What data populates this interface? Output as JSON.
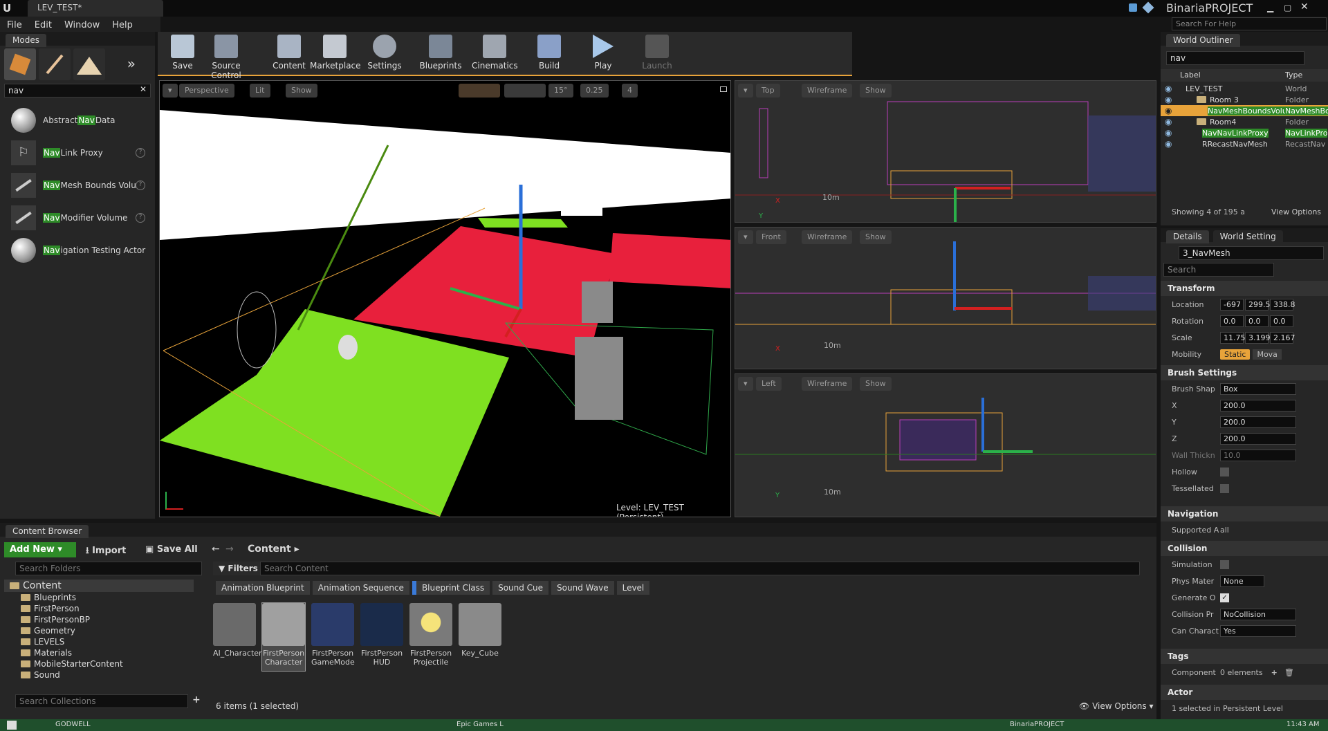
{
  "window": {
    "tab_title": "LEV_TEST*",
    "project": "BinariaPROJECT",
    "search_help_placeholder": "Search For Help"
  },
  "menu": [
    "File",
    "Edit",
    "Window",
    "Help"
  ],
  "modes": {
    "title": "Modes",
    "search_value": "nav",
    "items": [
      {
        "prefix": "Abstract ",
        "hl": "Nav",
        "suffix": " Data",
        "help": false
      },
      {
        "prefix": "",
        "hl": "Nav",
        "suffix": " Link Proxy",
        "help": true
      },
      {
        "prefix": "",
        "hl": "Nav",
        "suffix": " Mesh Bounds Volu",
        "help": true
      },
      {
        "prefix": "",
        "hl": "Nav",
        "suffix": " Modifier Volume",
        "help": true
      },
      {
        "prefix": "",
        "hl": "Nav",
        "suffix": "igation Testing Actor",
        "help": false
      }
    ]
  },
  "toolbar": [
    "Save",
    "Source Control",
    "Content",
    "Marketplace",
    "Settings",
    "Blueprints",
    "Cinematics",
    "Build",
    "Play",
    "Launch"
  ],
  "viewport_main": {
    "mode": "Perspective",
    "lit": "Lit",
    "show": "Show",
    "snap_angle": "15°",
    "snap_scale": "0.25",
    "cam_speed": "4",
    "level_label": "Level:",
    "level_name": "LEV_TEST (Persistent)"
  },
  "viewports": [
    {
      "view": "Top",
      "mode": "Wireframe",
      "show": "Show",
      "scale": "10m",
      "axis_a": "X",
      "axis_b": "Y"
    },
    {
      "view": "Front",
      "mode": "Wireframe",
      "show": "Show",
      "scale": "10m",
      "axis_a": "X",
      "axis_b": ""
    },
    {
      "view": "Left",
      "mode": "Wireframe",
      "show": "Show",
      "scale": "10m",
      "axis_a": "Y",
      "axis_b": ""
    }
  ],
  "outliner": {
    "title": "World Outliner",
    "search_value": "nav",
    "col_label": "Label",
    "col_type": "Type",
    "rows": [
      {
        "label": "LEV_TEST",
        "type": "World",
        "indent": 0
      },
      {
        "label": "Room 3",
        "type": "Folder",
        "indent": 1
      },
      {
        "label": "NavMeshBoundsVolume",
        "type": "NavMeshBo",
        "indent": 2
      },
      {
        "label": "Room4",
        "type": "Folder",
        "indent": 1
      },
      {
        "label": "NavNavLinkProxy",
        "type": "NavLinkPro",
        "indent": 1
      },
      {
        "label": "RRecastNavMesh",
        "type": "RecastNav",
        "indent": 1
      }
    ],
    "status": "Showing 4 of 195 a",
    "view_options": "View Options"
  },
  "details": {
    "tab_details": "Details",
    "tab_world": "World Setting",
    "object_name": "3_NavMesh",
    "search_placeholder": "Search",
    "transform": {
      "title": "Transform",
      "location_label": "Location",
      "location": [
        "-697",
        "299.5",
        "338.8"
      ],
      "rotation_label": "Rotation",
      "rotation": [
        "0.0",
        "0.0",
        "0.0"
      ],
      "scale_label": "Scale",
      "scale": [
        "11.75",
        "3.199",
        "2.167"
      ],
      "mobility_label": "Mobility",
      "mobility_static": "Static",
      "mobility_movable": "Mova"
    },
    "brush": {
      "title": "Brush Settings",
      "shape_label": "Brush Shap",
      "shape": "Box",
      "x_label": "X",
      "x": "200.0",
      "y_label": "Y",
      "y": "200.0",
      "z_label": "Z",
      "z": "200.0",
      "wall_label": "Wall Thickn",
      "wall": "10.0",
      "hollow_label": "Hollow",
      "tess_label": "Tessellated"
    },
    "navigation": {
      "title": "Navigation",
      "supported_label": "Supported A",
      "supported": "all"
    },
    "collision": {
      "title": "Collision",
      "sim_label": "Simulation",
      "phys_label": "Phys Mater",
      "phys": "None",
      "gen_label": "Generate O",
      "preset_label": "Collision Pr",
      "preset": "NoCollision",
      "cc_label": "Can Charact",
      "cc": "Yes"
    },
    "tags": {
      "title": "Tags",
      "component_label": "Component",
      "component_value": "0 elements"
    },
    "actor": {
      "title": "Actor",
      "footer": "1 selected in Persistent Level"
    }
  },
  "content_browser": {
    "title": "Content Browser",
    "add_new": "Add New",
    "import": "Import",
    "save_all": "Save All",
    "path": "Content",
    "search_folders": "Search Folders",
    "search_content": "Search Content",
    "filters": "Filters",
    "search_collections": "Search Collections",
    "filter_chips": [
      "Animation Blueprint",
      "Animation Sequence",
      "Blueprint Class",
      "Sound Cue",
      "Sound Wave",
      "Level"
    ],
    "tree_root": "Content",
    "tree": [
      "Blueprints",
      "FirstPerson",
      "FirstPersonBP",
      "Geometry",
      "LEVELS",
      "Materials",
      "MobileStarterContent",
      "Sound"
    ],
    "assets": [
      {
        "name": "AI_Character"
      },
      {
        "name": "FirstPerson Character"
      },
      {
        "name": "FirstPerson GameMode"
      },
      {
        "name": "FirstPerson HUD"
      },
      {
        "name": "FirstPerson Projectile"
      },
      {
        "name": "Key_Cube"
      }
    ],
    "status": "6 items (1 selected)",
    "view_options": "View Options"
  },
  "taskbar": {
    "time": "11:43 AM",
    "item1": "GODWELL",
    "item2": "Epic Games L",
    "item3": "BinariaPROJECT"
  }
}
